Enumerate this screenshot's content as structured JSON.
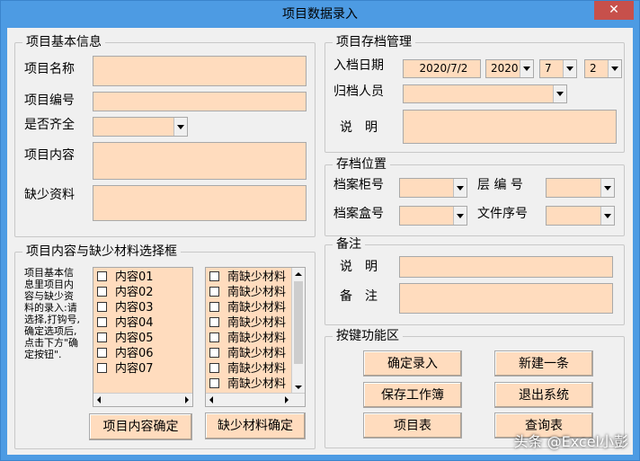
{
  "window": {
    "title": "项目数据录入",
    "close_label": "✕"
  },
  "basic": {
    "title": "项目基本信息",
    "name_label": "项目名称",
    "code_label": "项目编号",
    "complete_label": "是否齐全",
    "content_label": "项目内容",
    "missing_label": "缺少资料"
  },
  "archive": {
    "title": "项目存档管理",
    "date_label": "入档日期",
    "date_value": "2020/7/2",
    "year": "2020",
    "month": "7",
    "day": "2",
    "person_label": "归档人员",
    "desc_label": "说　明"
  },
  "location": {
    "title": "存档位置",
    "cabinet_label": "档案柜号",
    "layer_label": "层 编 号",
    "box_label": "档案盒号",
    "fileno_label": "文件序号"
  },
  "remark": {
    "title": "备注",
    "desc_label": "说　明",
    "note_label": "备　注"
  },
  "select": {
    "title": "项目内容与缺少材料选择框",
    "hint": "项目基本信\n息里项目内\n容与缺少资\n料的录入:请\n选择,打钩号,\n确定选项后,\n点击下方\"确\n定按钮\".",
    "contents": [
      "内容01",
      "内容02",
      "内容03",
      "内容04",
      "内容05",
      "内容06",
      "内容07"
    ],
    "missing": [
      "南缺少材料",
      "南缺少材料",
      "南缺少材料",
      "南缺少材料",
      "南缺少材料",
      "南缺少材料",
      "南缺少材料",
      "南缺少材料"
    ],
    "confirm_content": "项目内容确定",
    "confirm_missing": "缺少材料确定"
  },
  "actions": {
    "title": "按键功能区",
    "confirm": "确定录入",
    "new": "新建一条",
    "save": "保存工作簿",
    "exit": "退出系统",
    "list": "项目表",
    "query": "查询表"
  },
  "watermark": "头条 @Excel小彭"
}
